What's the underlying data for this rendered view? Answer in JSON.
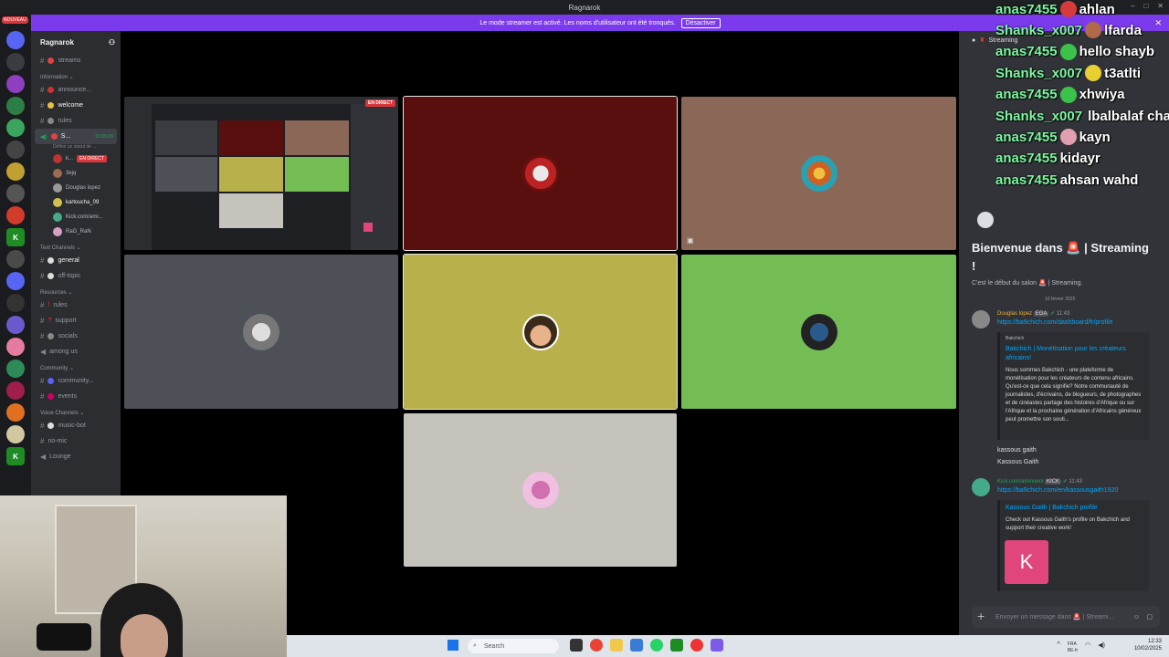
{
  "window": {
    "title": "Ragnarok",
    "controls": [
      "–",
      "□",
      "✕"
    ]
  },
  "streamer_bar": {
    "text": "Le mode streamer est activé. Les noms d'utilisateur ont été tronqués.",
    "button": "Désactiver"
  },
  "rail": {
    "new_badge": "NOUVEAU"
  },
  "sidebar": {
    "server_name": "Ragnarok",
    "top_channel": "streams",
    "categories": {
      "information": "Information ⌄",
      "text": "Text Channels ⌄",
      "resources": "Resources ⌄",
      "community": "Community ⌄",
      "voice": "Voice Channels ⌄"
    },
    "info_channels": [
      "announce...",
      "welcome",
      "rules"
    ],
    "voice_channel": {
      "name": "S...",
      "timer": "03:05:09",
      "sub": "Définir un statut de ..."
    },
    "members": [
      {
        "name": "k...",
        "badge": "EN DIRECT"
      },
      {
        "name": "3ejq"
      },
      {
        "name": "Douglas lopez"
      },
      {
        "name": "kartoucha_09"
      },
      {
        "name": "Kick.com/ami..."
      },
      {
        "name": "RaG_RaN"
      }
    ],
    "text_channels": [
      "general",
      "off-topic"
    ],
    "resource_channels": [
      "rules",
      "support",
      "socials",
      "among us"
    ],
    "community_channels": [
      "community...",
      "events"
    ],
    "voice_channels": [
      "music-bot",
      "no-mic",
      "Lounge"
    ]
  },
  "screenshare": {
    "live_badge": "EN DIRECT"
  },
  "chat": {
    "header": "Streaming",
    "welcome_title": "Bienvenue dans 🚨 | Streaming !",
    "welcome_sub": "C'est le début du salon 🚨 | Streaming.",
    "date": "10 février 2025",
    "msg1": {
      "author": "Douglas lopez",
      "tag": "EGA",
      "time": "11:43",
      "link": "https://ba9chich.com/dashboard/fr/profile",
      "embed_site": "Bakchich",
      "embed_title": "Bakchich | Monétisation pour les créateurs africains!",
      "embed_desc": "Nous sommes Bakchich - une plateforme de monétisation pour les créateurs de contenu africains. Qu'est-ce que cela signifie? Notre communauté de journalistes, d'écrivains, de blogueurs, de photographes et de cinéastes partage des histoires d'Afrique ou sur l'Afrique et la prochaine génération d'Africains généreux peut promettre son souti..."
    },
    "plain1": "kassous gaith",
    "plain2": "Kassous Gaith",
    "msg2": {
      "author": "Kick.com/aminoeni",
      "tag": "KICK",
      "time": "11:43",
      "link": "https://ba9chich.com/en/kassousgaith1920",
      "embed_title": "Kassous Gaith | Bakchich profile",
      "embed_desc": "Check out Kassous Gaith's profile on Bakchich and support their creative work!",
      "k_letter": "K"
    },
    "composer_placeholder": "Envoyer un message dans 🚨 | Streami..."
  },
  "overlay_chat": [
    {
      "user": "anas7455",
      "text": "ahlan",
      "emote_color": "#d63a3a"
    },
    {
      "user": "Shanks_x007",
      "text": "lfarda",
      "emote_color": "#b06a4a"
    },
    {
      "user": "anas7455",
      "text": "hello shayb",
      "emote_color": "#3ac24a"
    },
    {
      "user": "Shanks_x007",
      "text": "t3atlti",
      "emote_color": "#e8d030"
    },
    {
      "user": "anas7455",
      "text": "xhwiya",
      "emote_color": "#3ac24a"
    },
    {
      "user": "Shanks_x007",
      "text": "lbalbalaf chat",
      "emote_color": "#c08060"
    },
    {
      "user": "anas7455",
      "text": "kayn",
      "emote_color": "#e0a0b0"
    },
    {
      "user": "anas7455",
      "text": "kidayr",
      "emote_color": ""
    },
    {
      "user": "anas7455",
      "text": "ahsan wahd",
      "emote_color": ""
    }
  ],
  "taskbar": {
    "search": "Search",
    "lang": "FRA",
    "lang2": "BE-fr",
    "time": "12:33",
    "date": "10/02/2025"
  },
  "colors": {
    "accent": "#7c3aed",
    "tile_red": "#5a0f0f",
    "tile_brown": "#8a6757",
    "tile_gray": "#4d5056",
    "tile_yellow": "#b8b04a",
    "tile_green": "#74bd54",
    "tile_light": "#c6c3bd"
  }
}
